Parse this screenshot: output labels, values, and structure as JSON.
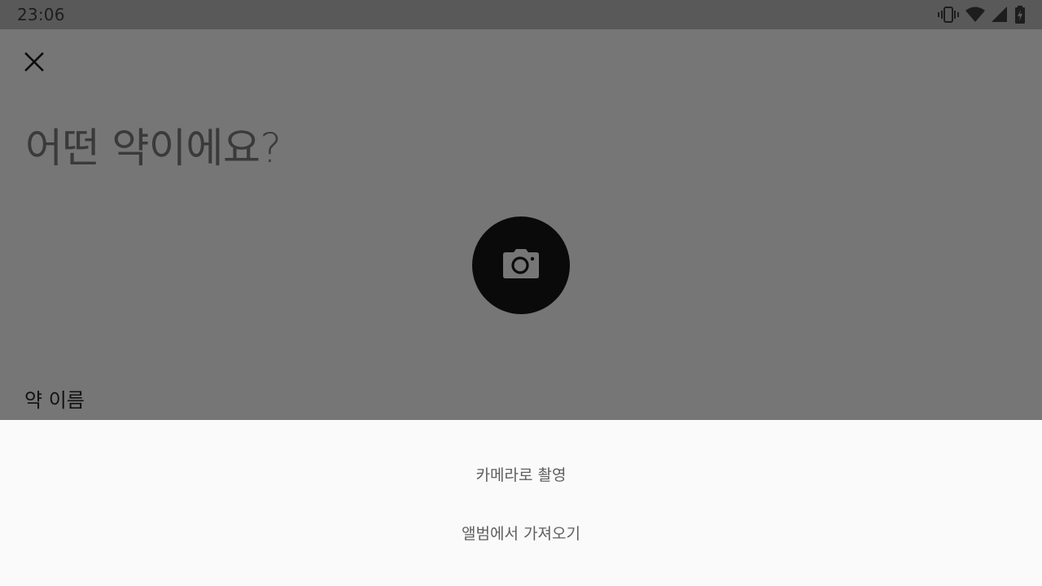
{
  "status_bar": {
    "time": "23:06",
    "icons": [
      "vibrate-icon",
      "wifi-icon",
      "cell-signal-icon",
      "battery-charging-icon"
    ]
  },
  "header": {
    "close_icon": "close-icon"
  },
  "main": {
    "title": "어떤 약이에요?",
    "camera_icon": "camera-icon",
    "field_label": "약 이름"
  },
  "bottom_sheet": {
    "options": [
      {
        "label": "카메라로 촬영"
      },
      {
        "label": "앨범에서 가져오기"
      }
    ]
  },
  "colors": {
    "status_bar_bg": "#595959",
    "scrim": "#767676",
    "sheet_bg": "#fafafa",
    "camera_button": "#0a0a0a"
  }
}
